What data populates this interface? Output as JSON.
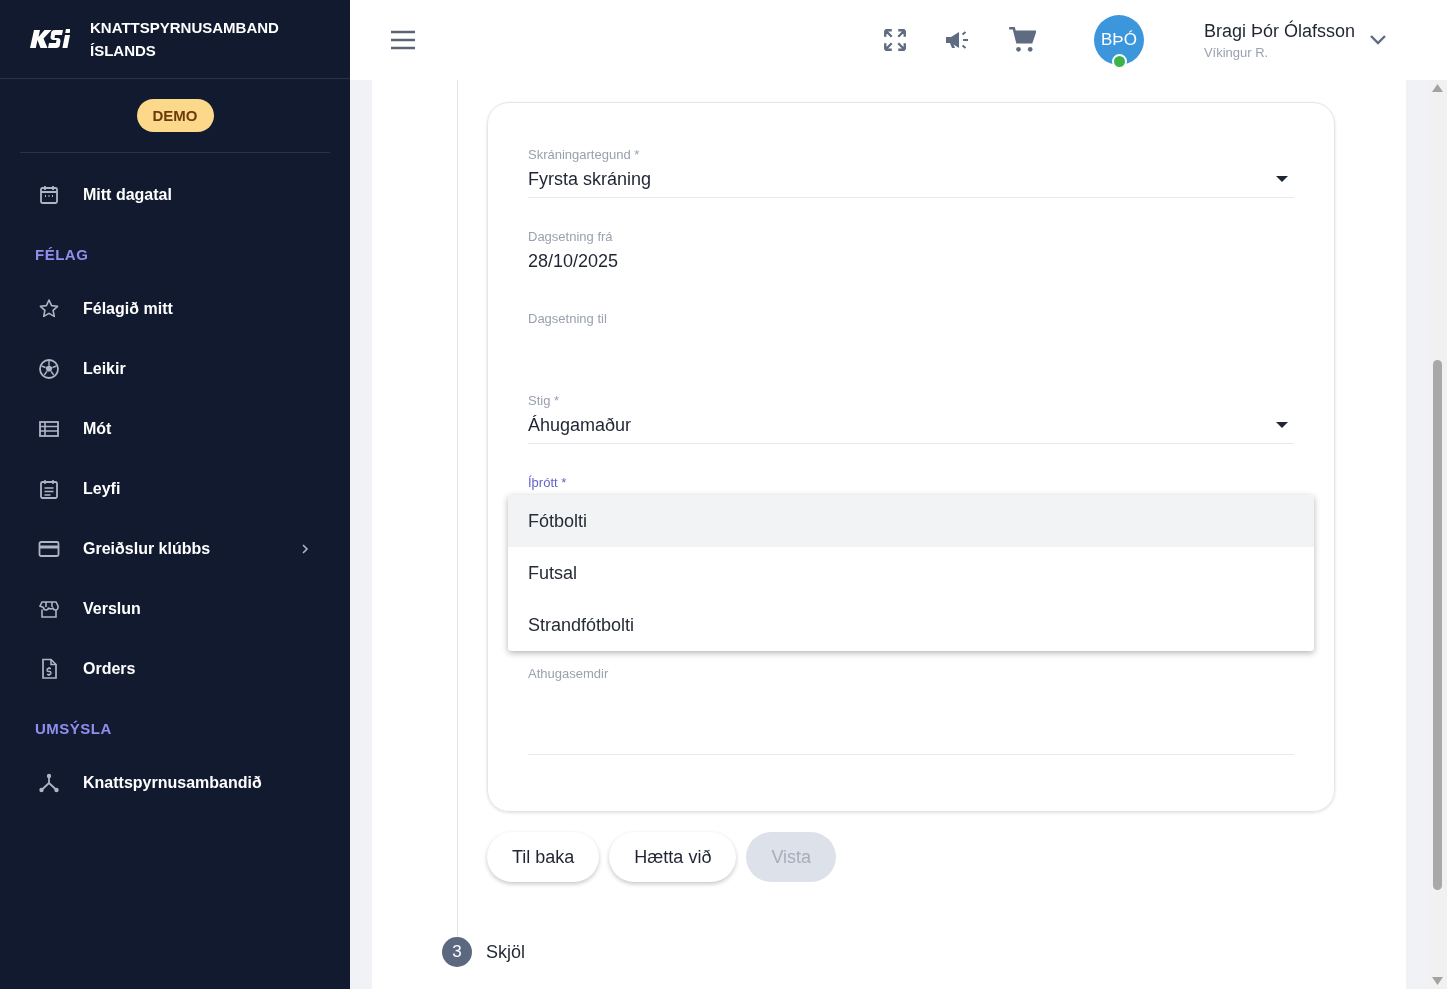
{
  "brand": {
    "title": "KNATTSPYRNUSAMBAND ÍSLANDS"
  },
  "badge": "DEMO",
  "sidebar": {
    "items": [
      {
        "kind": "link",
        "label": "Mitt dagatal",
        "has_submenu": false
      },
      {
        "kind": "section",
        "label": "FÉLAG"
      },
      {
        "kind": "link",
        "label": "Félagið mitt",
        "has_submenu": false
      },
      {
        "kind": "link",
        "label": "Leikir",
        "has_submenu": false
      },
      {
        "kind": "link",
        "label": "Mót",
        "has_submenu": false
      },
      {
        "kind": "link",
        "label": "Leyfi",
        "has_submenu": false
      },
      {
        "kind": "link",
        "label": "Greiðslur klúbbs",
        "has_submenu": true
      },
      {
        "kind": "link",
        "label": "Verslun",
        "has_submenu": false
      },
      {
        "kind": "link",
        "label": "Orders",
        "has_submenu": false
      },
      {
        "kind": "section",
        "label": "UMSÝSLA"
      },
      {
        "kind": "link",
        "label": "Knattspyrnusambandið",
        "has_submenu": false
      }
    ]
  },
  "user": {
    "initials": "BÞÓ",
    "online": true,
    "name": "Bragi Þór Ólafsson",
    "club": "Víkingur R."
  },
  "form": {
    "fields": [
      {
        "kind": "select",
        "label": "Skráningartegund *",
        "value": "Fyrsta skráning"
      },
      {
        "kind": "text",
        "label": "Dagsetning frá",
        "value": "28/10/2025"
      },
      {
        "kind": "text",
        "label": "Dagsetning til"
      },
      {
        "kind": "select",
        "label": "Stig *",
        "value": "Áhugamaður"
      },
      {
        "kind": "open_select",
        "label": "Íþrótt *",
        "options": [
          {
            "label": "Fótbolti",
            "selected": true
          },
          {
            "label": "Futsal",
            "selected": false
          },
          {
            "label": "Strandfótbolti",
            "selected": false
          }
        ]
      },
      {
        "kind": "text",
        "label": "Athugasemdir"
      }
    ]
  },
  "buttons": [
    {
      "label": "Til baka",
      "disabled": false
    },
    {
      "label": "Hætta við",
      "disabled": false
    },
    {
      "label": "Vista",
      "disabled": true
    }
  ],
  "next_step": {
    "number": "3",
    "label": "Skjöl"
  }
}
